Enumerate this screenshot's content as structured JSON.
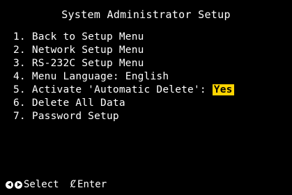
{
  "title": "System Administrator Setup",
  "menu": {
    "items": [
      {
        "number": "1.",
        "label": "Back to Setup Menu"
      },
      {
        "number": "2.",
        "label": "Network Setup Menu"
      },
      {
        "number": "3.",
        "label": "RS-232C Setup Menu"
      },
      {
        "number": "4.",
        "label": "Menu Language: English"
      },
      {
        "number": "5.",
        "label": "Activate 'Automatic Delete':",
        "value": "Yes"
      },
      {
        "number": "6.",
        "label": "Delete All Data"
      },
      {
        "number": "7.",
        "label": "Password Setup"
      }
    ]
  },
  "footer": {
    "select_label": "Select",
    "enter_icon": "Ȼ",
    "enter_label": "Enter"
  },
  "colors": {
    "background": "#000000",
    "text": "#ffffff",
    "highlight": "#ffd400"
  },
  "icons": {
    "left": "left-arrow-circle-icon",
    "right": "right-arrow-circle-icon",
    "enter": "enter-icon"
  }
}
